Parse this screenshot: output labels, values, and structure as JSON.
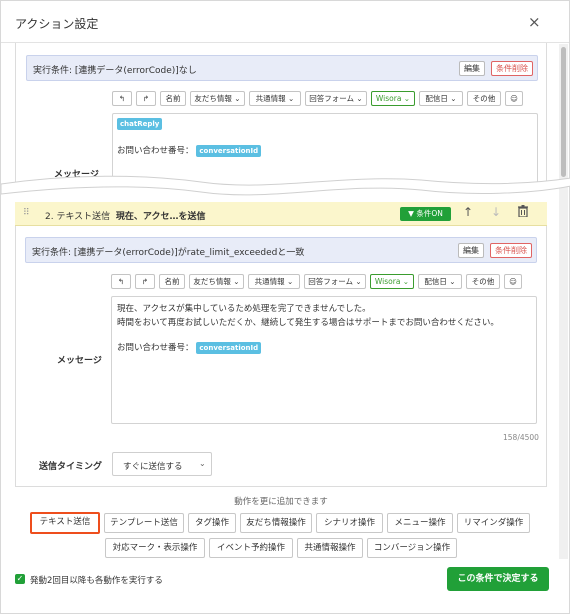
{
  "modal": {
    "title": "アクション設定",
    "close": "×"
  },
  "top_section": {
    "condition": "実行条件: [連携データ(errorCode)]なし",
    "edit_label": "編集",
    "delete_label": "条件削除",
    "toolbar": [
      "↰",
      "↱",
      "名前",
      "友だち情報 ⌄",
      "共通情報 ⌄",
      "回答フォーム ⌄",
      "Wisora ⌄",
      "配信日 ⌄",
      "その他",
      "☺"
    ],
    "message": {
      "tag1": "chatReply",
      "line_prefix": "お問い合わせ番号：",
      "tag2": "conversationId"
    },
    "partial_label": "メッセージ"
  },
  "action2": {
    "number": "2. テキスト送信",
    "summary": "現在、アクセ…を送信",
    "condition_on_label": "条件ON",
    "condition": "実行条件: [連携データ(errorCode)]がrate_limit_exceededと一致",
    "edit_label": "編集",
    "delete_label": "条件削除",
    "toolbar": [
      "↰",
      "↱",
      "名前",
      "友だち情報 ⌄",
      "共通情報 ⌄",
      "回答フォーム ⌄",
      "Wisora ⌄",
      "配信日 ⌄",
      "その他",
      "☺"
    ],
    "message_label": "メッセージ",
    "message_lines": [
      "現在、アクセスが集中しているため処理を完了できませんでした。",
      "時間をおいて再度お試しいただくか、継続して発生する場合はサポートまでお問い合わせください。"
    ],
    "message_ref_prefix": "お問い合わせ番号：",
    "message_ref_tag": "conversationId",
    "char_count": "158/4500",
    "timing_label": "送信タイミング",
    "timing_value": "すぐに送信する"
  },
  "add_actions": {
    "label": "動作を更に追加できます",
    "row1": [
      "テキスト送信",
      "テンプレート送信",
      "タグ操作",
      "友だち情報操作",
      "シナリオ操作",
      "メニュー操作",
      "リマインダ操作"
    ],
    "row2": [
      "対応マーク・表示操作",
      "イベント予約操作",
      "共通情報操作",
      "コンバージョン操作"
    ]
  },
  "footer": {
    "checkbox_label": "発動2回目以降も各動作を実行する",
    "checkbox_checked": true,
    "submit_label": "この条件で決定する"
  },
  "colors": {
    "accent_green": "#21a038",
    "condition_bg": "#e8ecf8",
    "action_header_bg": "#fbf6cc",
    "variable_tag": "#5bbfe2",
    "highlight_border": "#ee4e1d",
    "delete_red": "#d9534f"
  },
  "icons": {
    "drag_handle": "grip-icon",
    "filter": "filter-icon",
    "move_up": "arrow-up-icon",
    "move_down": "arrow-down-icon",
    "trash": "trash-icon",
    "emoji": "emoji-icon",
    "undo": "undo-icon",
    "redo": "redo-icon",
    "check": "check-icon",
    "close": "close-icon"
  }
}
